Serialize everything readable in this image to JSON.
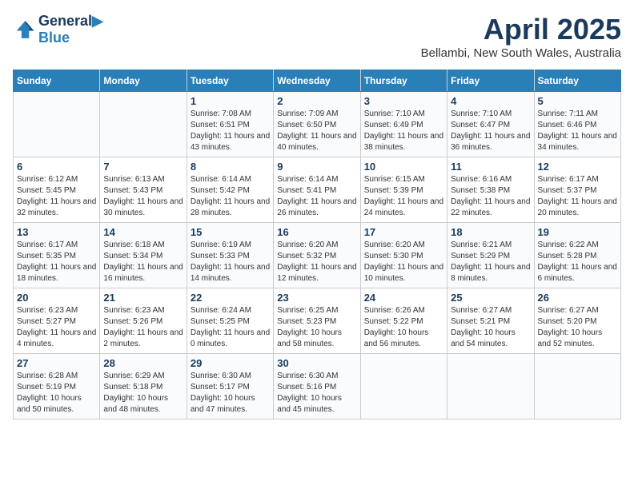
{
  "header": {
    "logo_line1": "General",
    "logo_line2": "Blue",
    "month_title": "April 2025",
    "subtitle": "Bellambi, New South Wales, Australia"
  },
  "weekdays": [
    "Sunday",
    "Monday",
    "Tuesday",
    "Wednesday",
    "Thursday",
    "Friday",
    "Saturday"
  ],
  "weeks": [
    [
      {
        "day": "",
        "sunrise": "",
        "sunset": "",
        "daylight": ""
      },
      {
        "day": "",
        "sunrise": "",
        "sunset": "",
        "daylight": ""
      },
      {
        "day": "1",
        "sunrise": "Sunrise: 7:08 AM",
        "sunset": "Sunset: 6:51 PM",
        "daylight": "Daylight: 11 hours and 43 minutes."
      },
      {
        "day": "2",
        "sunrise": "Sunrise: 7:09 AM",
        "sunset": "Sunset: 6:50 PM",
        "daylight": "Daylight: 11 hours and 40 minutes."
      },
      {
        "day": "3",
        "sunrise": "Sunrise: 7:10 AM",
        "sunset": "Sunset: 6:49 PM",
        "daylight": "Daylight: 11 hours and 38 minutes."
      },
      {
        "day": "4",
        "sunrise": "Sunrise: 7:10 AM",
        "sunset": "Sunset: 6:47 PM",
        "daylight": "Daylight: 11 hours and 36 minutes."
      },
      {
        "day": "5",
        "sunrise": "Sunrise: 7:11 AM",
        "sunset": "Sunset: 6:46 PM",
        "daylight": "Daylight: 11 hours and 34 minutes."
      }
    ],
    [
      {
        "day": "6",
        "sunrise": "Sunrise: 6:12 AM",
        "sunset": "Sunset: 5:45 PM",
        "daylight": "Daylight: 11 hours and 32 minutes."
      },
      {
        "day": "7",
        "sunrise": "Sunrise: 6:13 AM",
        "sunset": "Sunset: 5:43 PM",
        "daylight": "Daylight: 11 hours and 30 minutes."
      },
      {
        "day": "8",
        "sunrise": "Sunrise: 6:14 AM",
        "sunset": "Sunset: 5:42 PM",
        "daylight": "Daylight: 11 hours and 28 minutes."
      },
      {
        "day": "9",
        "sunrise": "Sunrise: 6:14 AM",
        "sunset": "Sunset: 5:41 PM",
        "daylight": "Daylight: 11 hours and 26 minutes."
      },
      {
        "day": "10",
        "sunrise": "Sunrise: 6:15 AM",
        "sunset": "Sunset: 5:39 PM",
        "daylight": "Daylight: 11 hours and 24 minutes."
      },
      {
        "day": "11",
        "sunrise": "Sunrise: 6:16 AM",
        "sunset": "Sunset: 5:38 PM",
        "daylight": "Daylight: 11 hours and 22 minutes."
      },
      {
        "day": "12",
        "sunrise": "Sunrise: 6:17 AM",
        "sunset": "Sunset: 5:37 PM",
        "daylight": "Daylight: 11 hours and 20 minutes."
      }
    ],
    [
      {
        "day": "13",
        "sunrise": "Sunrise: 6:17 AM",
        "sunset": "Sunset: 5:35 PM",
        "daylight": "Daylight: 11 hours and 18 minutes."
      },
      {
        "day": "14",
        "sunrise": "Sunrise: 6:18 AM",
        "sunset": "Sunset: 5:34 PM",
        "daylight": "Daylight: 11 hours and 16 minutes."
      },
      {
        "day": "15",
        "sunrise": "Sunrise: 6:19 AM",
        "sunset": "Sunset: 5:33 PM",
        "daylight": "Daylight: 11 hours and 14 minutes."
      },
      {
        "day": "16",
        "sunrise": "Sunrise: 6:20 AM",
        "sunset": "Sunset: 5:32 PM",
        "daylight": "Daylight: 11 hours and 12 minutes."
      },
      {
        "day": "17",
        "sunrise": "Sunrise: 6:20 AM",
        "sunset": "Sunset: 5:30 PM",
        "daylight": "Daylight: 11 hours and 10 minutes."
      },
      {
        "day": "18",
        "sunrise": "Sunrise: 6:21 AM",
        "sunset": "Sunset: 5:29 PM",
        "daylight": "Daylight: 11 hours and 8 minutes."
      },
      {
        "day": "19",
        "sunrise": "Sunrise: 6:22 AM",
        "sunset": "Sunset: 5:28 PM",
        "daylight": "Daylight: 11 hours and 6 minutes."
      }
    ],
    [
      {
        "day": "20",
        "sunrise": "Sunrise: 6:23 AM",
        "sunset": "Sunset: 5:27 PM",
        "daylight": "Daylight: 11 hours and 4 minutes."
      },
      {
        "day": "21",
        "sunrise": "Sunrise: 6:23 AM",
        "sunset": "Sunset: 5:26 PM",
        "daylight": "Daylight: 11 hours and 2 minutes."
      },
      {
        "day": "22",
        "sunrise": "Sunrise: 6:24 AM",
        "sunset": "Sunset: 5:25 PM",
        "daylight": "Daylight: 11 hours and 0 minutes."
      },
      {
        "day": "23",
        "sunrise": "Sunrise: 6:25 AM",
        "sunset": "Sunset: 5:23 PM",
        "daylight": "Daylight: 10 hours and 58 minutes."
      },
      {
        "day": "24",
        "sunrise": "Sunrise: 6:26 AM",
        "sunset": "Sunset: 5:22 PM",
        "daylight": "Daylight: 10 hours and 56 minutes."
      },
      {
        "day": "25",
        "sunrise": "Sunrise: 6:27 AM",
        "sunset": "Sunset: 5:21 PM",
        "daylight": "Daylight: 10 hours and 54 minutes."
      },
      {
        "day": "26",
        "sunrise": "Sunrise: 6:27 AM",
        "sunset": "Sunset: 5:20 PM",
        "daylight": "Daylight: 10 hours and 52 minutes."
      }
    ],
    [
      {
        "day": "27",
        "sunrise": "Sunrise: 6:28 AM",
        "sunset": "Sunset: 5:19 PM",
        "daylight": "Daylight: 10 hours and 50 minutes."
      },
      {
        "day": "28",
        "sunrise": "Sunrise: 6:29 AM",
        "sunset": "Sunset: 5:18 PM",
        "daylight": "Daylight: 10 hours and 48 minutes."
      },
      {
        "day": "29",
        "sunrise": "Sunrise: 6:30 AM",
        "sunset": "Sunset: 5:17 PM",
        "daylight": "Daylight: 10 hours and 47 minutes."
      },
      {
        "day": "30",
        "sunrise": "Sunrise: 6:30 AM",
        "sunset": "Sunset: 5:16 PM",
        "daylight": "Daylight: 10 hours and 45 minutes."
      },
      {
        "day": "",
        "sunrise": "",
        "sunset": "",
        "daylight": ""
      },
      {
        "day": "",
        "sunrise": "",
        "sunset": "",
        "daylight": ""
      },
      {
        "day": "",
        "sunrise": "",
        "sunset": "",
        "daylight": ""
      }
    ]
  ]
}
